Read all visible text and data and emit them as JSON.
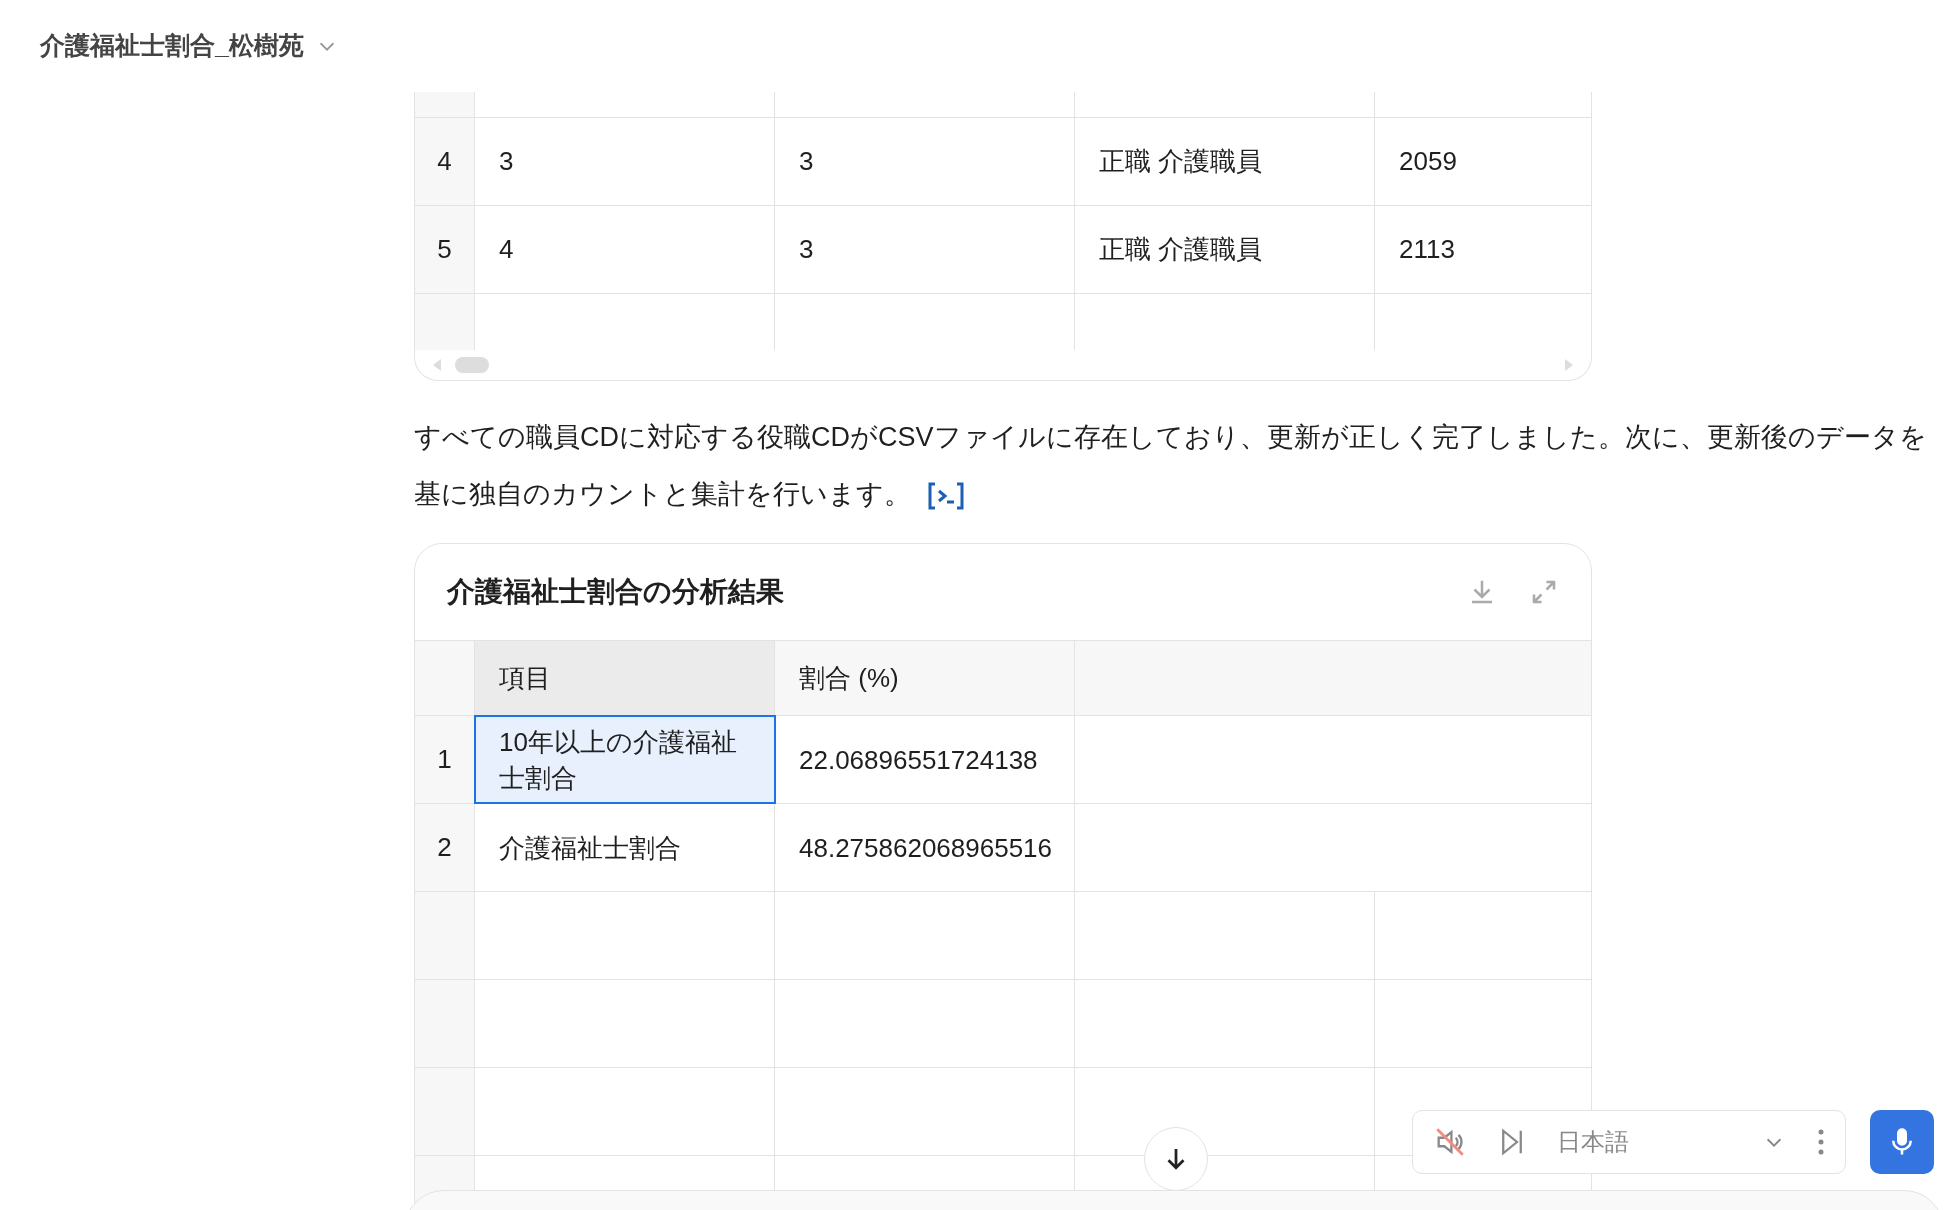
{
  "header": {
    "title": "介護福祉士割合_松樹苑"
  },
  "top_table": {
    "rows": [
      {
        "index": "4",
        "cells": [
          "3",
          "3",
          "正職 介護職員",
          "2059"
        ]
      },
      {
        "index": "5",
        "cells": [
          "4",
          "3",
          "正職 介護職員",
          "2113"
        ]
      }
    ]
  },
  "message": {
    "text": "すべての職員CDに対応する役職CDがCSVファイルに存在しており、更新が正しく完了しました。次に、更新後のデータを基に独自のカウントと集計を行います。"
  },
  "result_card": {
    "title": "介護福祉士割合の分析結果",
    "columns": [
      {
        "label": "項目",
        "selected": true
      },
      {
        "label": "割合 (%)",
        "selected": false
      }
    ],
    "rows": [
      {
        "index": "1",
        "cells": [
          {
            "text": "10年以上の介護福祉士割合",
            "selected": true
          },
          {
            "text": "22.06896551724138",
            "selected": false
          }
        ]
      },
      {
        "index": "2",
        "cells": [
          {
            "text": "介護福祉士割合",
            "selected": false
          },
          {
            "text": "48.275862068965516",
            "selected": false
          }
        ]
      }
    ]
  },
  "voice_bar": {
    "muted": true,
    "language": "日本語"
  }
}
